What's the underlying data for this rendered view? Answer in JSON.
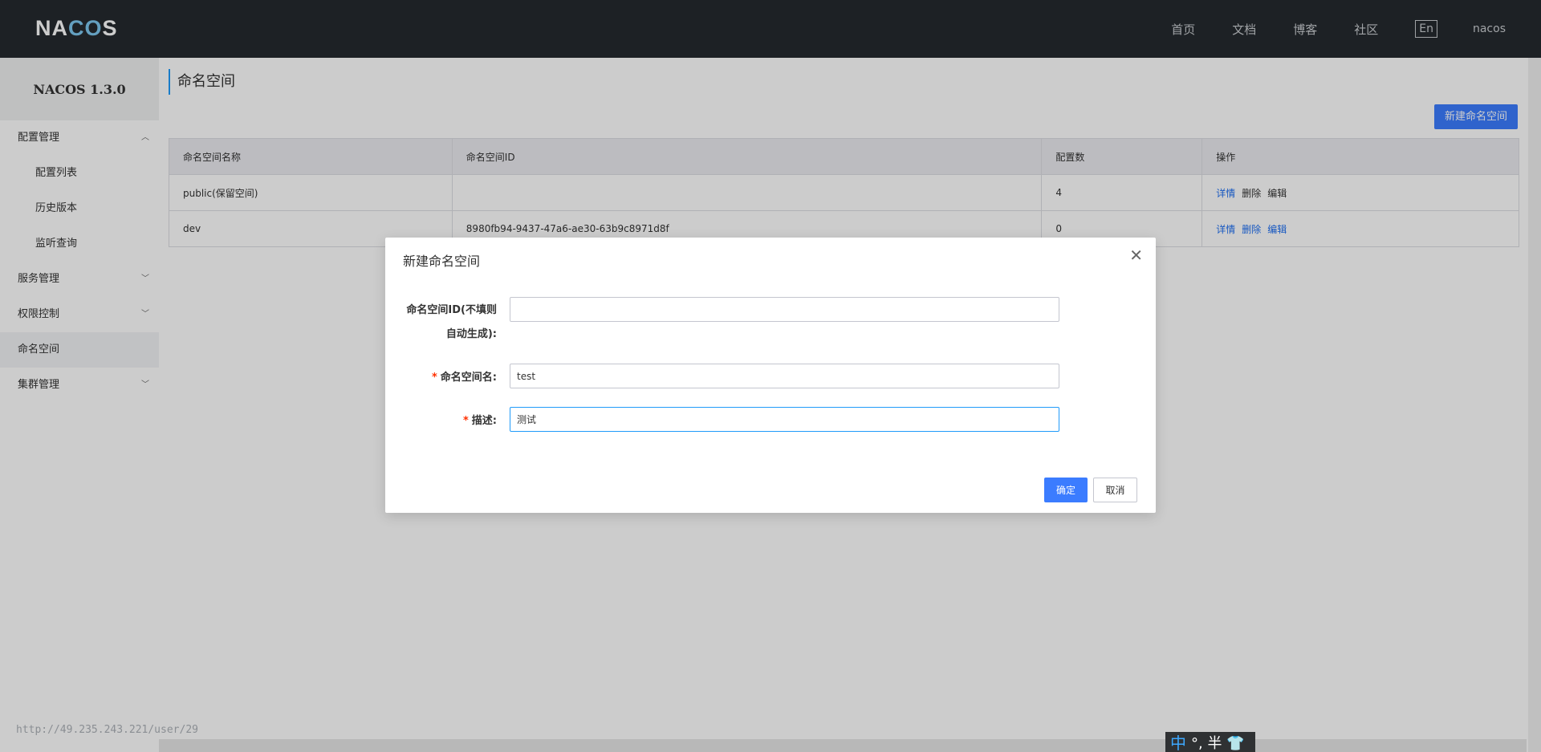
{
  "header": {
    "logo": {
      "pre": "NA",
      "mid": "CO",
      "post": "S"
    },
    "nav": [
      "首页",
      "文档",
      "博客",
      "社区"
    ],
    "lang": "En",
    "user": "nacos"
  },
  "sidebar": {
    "title": "NACOS 1.3.0",
    "items": [
      {
        "label": "配置管理",
        "arrow": "︿"
      },
      {
        "label": "配置列表"
      },
      {
        "label": "历史版本"
      },
      {
        "label": "监听查询"
      },
      {
        "label": "服务管理",
        "arrow": "﹀"
      },
      {
        "label": "权限控制",
        "arrow": "﹀"
      },
      {
        "label": "命名空间"
      },
      {
        "label": "集群管理",
        "arrow": "﹀"
      }
    ]
  },
  "main": {
    "title": "命名空间",
    "new_button": "新建命名空间",
    "table": {
      "headers": [
        "命名空间名称",
        "命名空间ID",
        "配置数",
        "操作"
      ],
      "rows": [
        {
          "name": "public(保留空间)",
          "id": "",
          "count": "4",
          "actions": [
            "详情",
            "删除",
            "编辑"
          ]
        },
        {
          "name": "dev",
          "id": "8980fb94-9437-47a6-ae30-63b9c8971d8f",
          "count": "0",
          "actions": [
            "详情",
            "删除",
            "编辑"
          ]
        }
      ]
    }
  },
  "dialog": {
    "title": "新建命名空间",
    "close": "✕",
    "fields": {
      "id_label_1": "命名空间ID(不填则",
      "id_label_2": "自动生成):",
      "id_value": "",
      "name_req": "*",
      "name_label": "命名空间名:",
      "name_value": "test",
      "desc_req": "*",
      "desc_label": "描述:",
      "desc_value": "测试"
    },
    "ok": "确定",
    "cancel": "取消"
  },
  "status_url": "http://49.235.243.221/user/29",
  "ime": {
    "zh": "中",
    "rest": "°, 半 👕"
  }
}
